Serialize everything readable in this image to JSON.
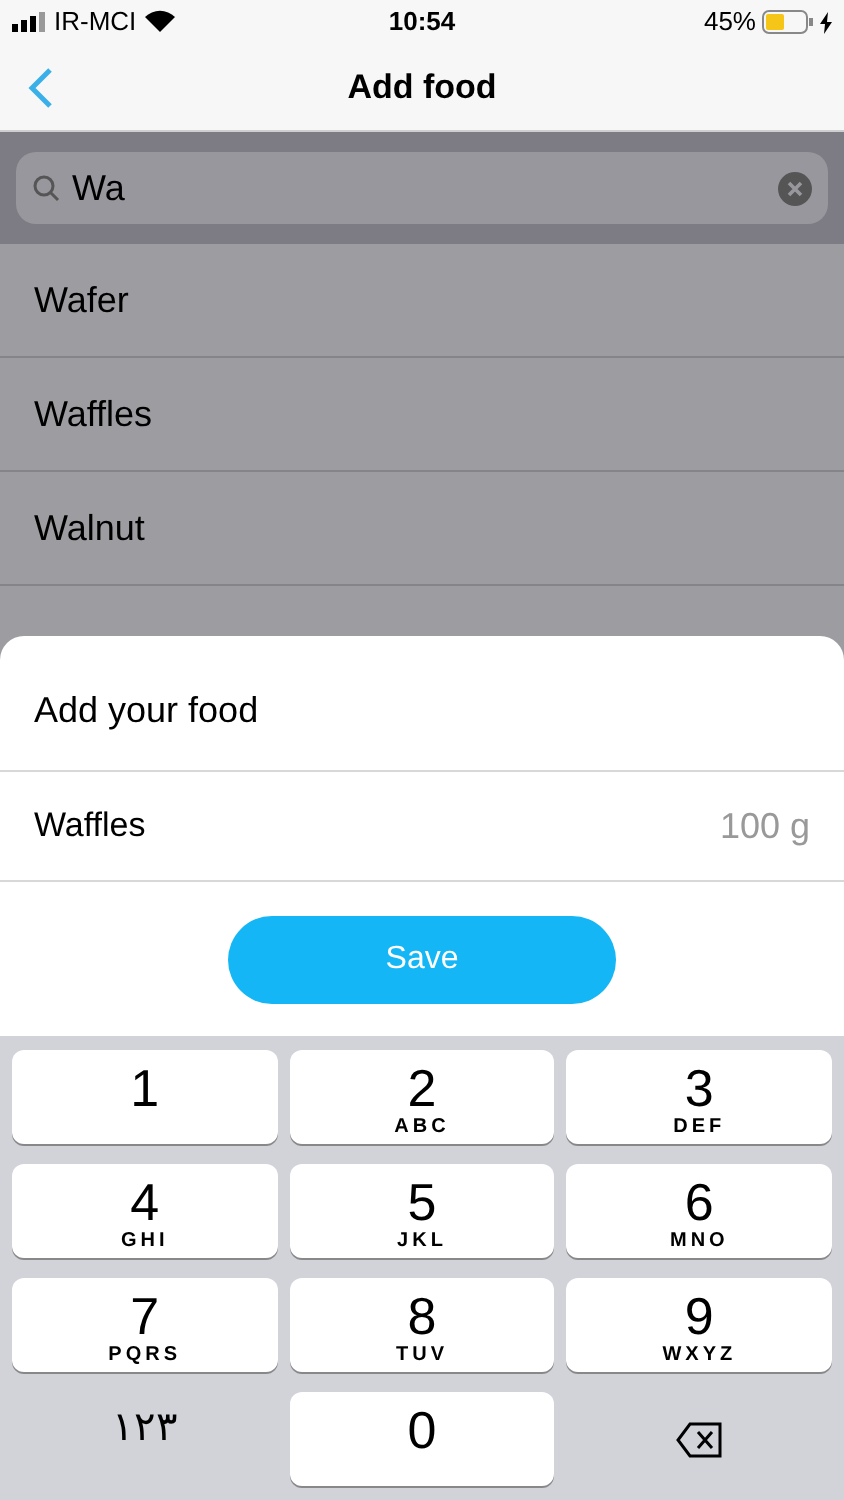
{
  "status_bar": {
    "carrier": "IR-MCI",
    "time": "10:54",
    "battery": "45%"
  },
  "nav": {
    "title": "Add food"
  },
  "search": {
    "value": "Wa"
  },
  "results": [
    {
      "name": "Wafer"
    },
    {
      "name": "Waffles"
    },
    {
      "name": "Walnut"
    }
  ],
  "sheet": {
    "title": "Add your food",
    "food": "Waffles",
    "amount": "100 g",
    "save": "Save"
  },
  "keypad": [
    {
      "kind": "digit",
      "digit": "1"
    },
    {
      "kind": "digit",
      "digit": "2",
      "letters": "ABC"
    },
    {
      "kind": "digit",
      "digit": "3",
      "letters": "DEF"
    },
    {
      "kind": "digit",
      "digit": "4",
      "letters": "GHI"
    },
    {
      "kind": "digit",
      "digit": "5",
      "letters": "JKL"
    },
    {
      "kind": "digit",
      "digit": "6",
      "letters": "MNO"
    },
    {
      "kind": "digit",
      "digit": "7",
      "letters": "PQRS"
    },
    {
      "kind": "digit",
      "digit": "8",
      "letters": "TUV"
    },
    {
      "kind": "digit",
      "digit": "9",
      "letters": "WXYZ"
    },
    {
      "kind": "switch",
      "label": "۱۲۳"
    },
    {
      "kind": "digit",
      "digit": "0"
    },
    {
      "kind": "delete"
    }
  ]
}
